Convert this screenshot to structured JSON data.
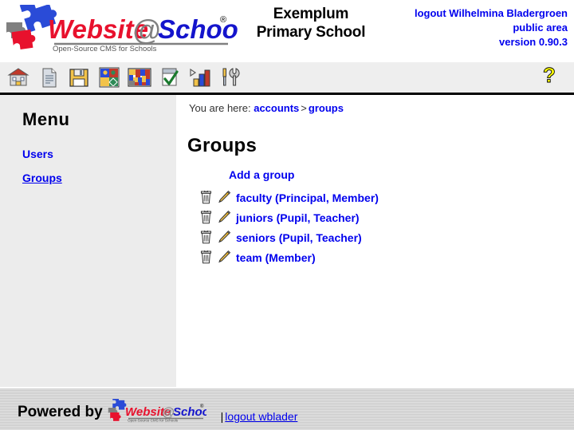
{
  "header": {
    "logo_alt": "Website@School",
    "logo_word1": "Website",
    "logo_at": "@",
    "logo_word2": "School",
    "logo_tagline": "Open-Source CMS for Schools",
    "logo_trademark": "®",
    "school_name_line1": "Exemplum",
    "school_name_line2": "Primary School",
    "logout_label": "logout Wilhelmina Bladergroen",
    "area_label": "public area",
    "version_label": "version 0.90.3"
  },
  "toolbar": {
    "items": [
      {
        "name": "home-icon",
        "title": "Home"
      },
      {
        "name": "page-icon",
        "title": "Pages"
      },
      {
        "name": "save-icon",
        "title": "Save"
      },
      {
        "name": "modules-icon",
        "title": "Modules"
      },
      {
        "name": "areas-icon",
        "title": "Areas"
      },
      {
        "name": "approve-icon",
        "title": "Approve"
      },
      {
        "name": "statistics-icon",
        "title": "Statistics"
      },
      {
        "name": "tools-icon",
        "title": "Tools"
      }
    ],
    "help": {
      "name": "help-icon",
      "glyph": "?",
      "title": "Help"
    }
  },
  "sidebar": {
    "title": "Menu",
    "items": [
      {
        "label": "Users",
        "current": false
      },
      {
        "label": "Groups",
        "current": true
      }
    ]
  },
  "breadcrumb": {
    "prefix": "You are here:",
    "items": [
      "accounts",
      "groups"
    ],
    "separator": ">"
  },
  "main": {
    "page_title": "Groups",
    "add_group_label": "Add a group",
    "groups": [
      {
        "name": "faculty",
        "open_paren": "(",
        "capacities": "Principal, Member",
        "close_paren": ")"
      },
      {
        "name": "juniors",
        "open_paren": "(",
        "capacities": "Pupil, Teacher",
        "close_paren": ")"
      },
      {
        "name": "seniors",
        "open_paren": "(",
        "capacities": "Pupil, Teacher",
        "close_paren": ")"
      },
      {
        "name": "team",
        "open_paren": "(",
        "capacities": "Member",
        "close_paren": ")"
      }
    ],
    "row_icons": {
      "delete": "trash-icon",
      "edit": "pencil-icon"
    }
  },
  "footer": {
    "powered_by": "Powered by",
    "logo_word1": "Website",
    "logo_at": "@",
    "logo_word2": "School",
    "logo_tagline": "Open-Source CMS for Schools",
    "logo_trademark": "®",
    "pipe": "|",
    "logout_label": "logout wblader"
  },
  "colors": {
    "link": "#0000ee",
    "toolbar_bg": "#eeeeee",
    "sidebar_bg": "#ececec",
    "footer_bg": "#c9c9c9",
    "logo_red": "#e8112d",
    "logo_blue": "#1414cc",
    "logo_gray": "#808080",
    "help_yellow": "#ffff00"
  }
}
